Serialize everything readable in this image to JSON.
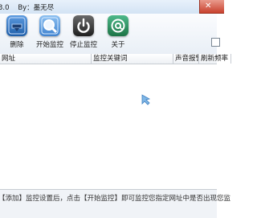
{
  "window": {
    "title": "3.0    By：墨无尽",
    "close_glyph": "✕"
  },
  "toolbar": {
    "buttons": [
      {
        "label": "删除",
        "icon": "delete-icon",
        "color": "#2f6fb5"
      },
      {
        "label": "开始监控",
        "icon": "search-icon",
        "color": "#4a8fd6"
      },
      {
        "label": "停止监控",
        "icon": "power-icon",
        "color": "#3a3a3a"
      },
      {
        "label": "关于",
        "icon": "at-icon",
        "color": "#2e9460"
      }
    ]
  },
  "list": {
    "columns": [
      "网址",
      "监控关键词",
      "声音报警",
      "刷新频率"
    ],
    "rows": []
  },
  "status": {
    "hint": "【添加】监控设置后，点击【开始监控】即可监控您指定网址中是否出现您监"
  }
}
